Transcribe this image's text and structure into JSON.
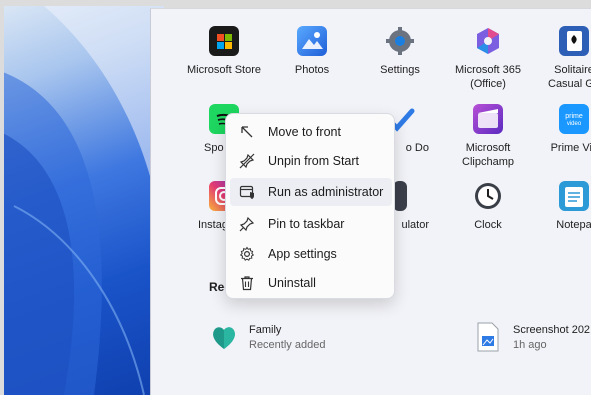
{
  "apps_row1": [
    {
      "label": "Microsoft Store",
      "icon": "microsoft-store-icon"
    },
    {
      "label": "Photos",
      "icon": "photos-icon"
    },
    {
      "label": "Settings",
      "icon": "settings-gear-icon"
    },
    {
      "label": "Microsoft 365",
      "label2": "(Office)",
      "icon": "microsoft-365-icon"
    },
    {
      "label": "Solitaire",
      "label2": "Casual Ga",
      "icon": "solitaire-icon"
    }
  ],
  "apps_row2": [
    {
      "label": "Spo",
      "icon": "spotify-icon"
    },
    {
      "label": "o Do",
      "icon": "todo-icon"
    },
    {
      "label": "Microsoft",
      "label2": "Clipchamp",
      "icon": "clipchamp-icon"
    },
    {
      "label": "Prime Vic",
      "icon": "prime-video-icon"
    }
  ],
  "apps_row3": [
    {
      "label": "Instag",
      "icon": "instagram-icon"
    },
    {
      "label": "ulator",
      "icon": "calculator-icon"
    },
    {
      "label": "Clock",
      "icon": "clock-icon"
    },
    {
      "label": "Notepa",
      "icon": "notepad-icon"
    }
  ],
  "recommended": {
    "title": "Rec",
    "items": [
      {
        "name": "Family",
        "sub": "Recently added",
        "icon": "family-heart-icon"
      },
      {
        "name": "Screenshot 202",
        "sub": "1h ago",
        "icon": "image-file-icon"
      }
    ]
  },
  "context_menu": {
    "items": [
      {
        "label": "Move to front",
        "icon": "move-to-front-icon"
      },
      {
        "label": "Unpin from Start",
        "icon": "unpin-icon"
      },
      {
        "label": "Run as administrator",
        "icon": "run-as-admin-icon"
      },
      {
        "label": "Pin to taskbar",
        "icon": "pin-icon"
      },
      {
        "label": "App settings",
        "icon": "gear-icon"
      },
      {
        "label": "Uninstall",
        "icon": "trash-icon"
      }
    ]
  },
  "colors": {
    "accent": "#1a54c9",
    "menu_bg": "#fbfbfc",
    "start_bg": "#f2f3f8"
  }
}
